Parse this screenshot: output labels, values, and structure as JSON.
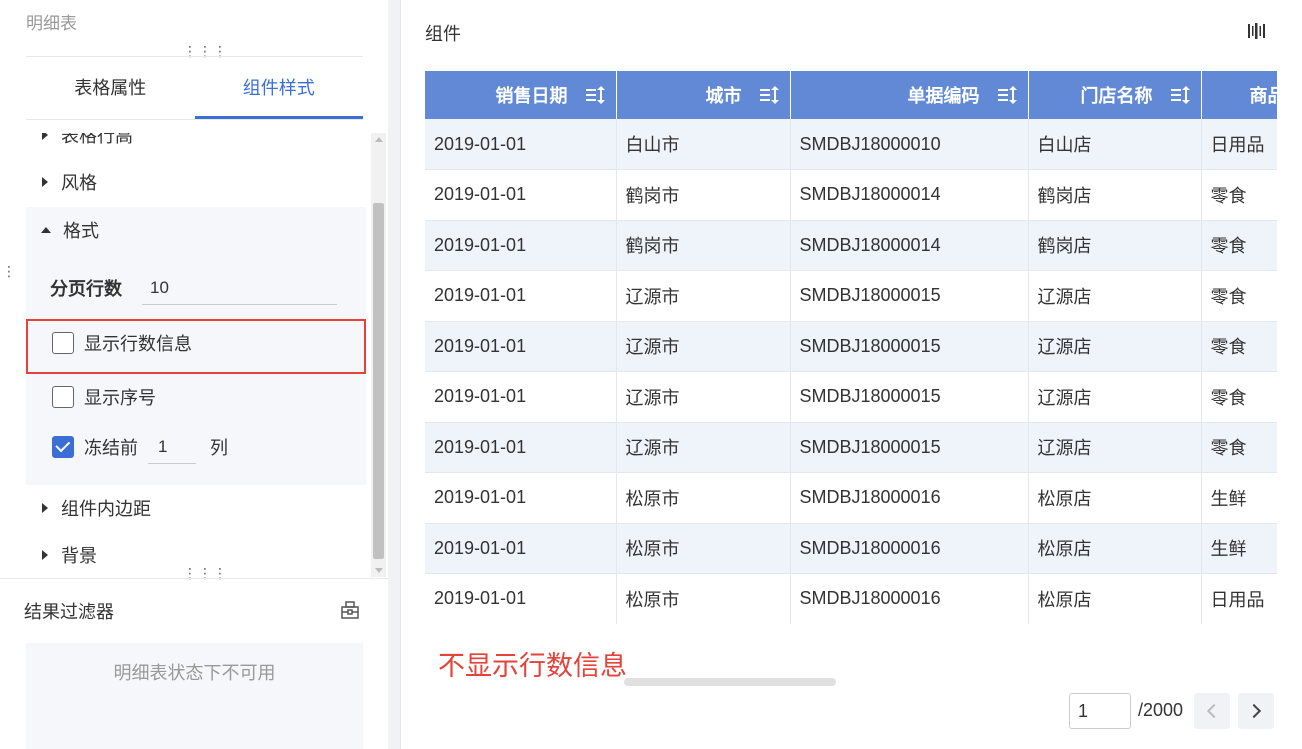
{
  "left": {
    "panel_title": "明细表",
    "tabs": [
      {
        "label": "表格属性",
        "active": false
      },
      {
        "label": "组件样式",
        "active": true
      }
    ],
    "sections": {
      "table_row_height": "表格行高",
      "style": "风格",
      "format": "格式",
      "padding": "组件内边距",
      "background": "背景"
    },
    "format": {
      "page_rows_label": "分页行数",
      "page_rows_value": "10",
      "show_row_count_label": "显示行数信息",
      "show_row_count_checked": false,
      "show_index_label": "显示序号",
      "show_index_checked": false,
      "freeze_prefix": "冻结前",
      "freeze_value": "1",
      "freeze_suffix": "列",
      "freeze_checked": true
    },
    "filter": {
      "title": "结果过滤器",
      "unavailable": "明细表状态下不可用"
    }
  },
  "right": {
    "title": "组件",
    "columns": [
      "销售日期",
      "城市",
      "单据编码",
      "门店名称",
      "商品"
    ],
    "rows": [
      [
        "2019-01-01",
        "白山市",
        "SMDBJ18000010",
        "白山店",
        "日用品"
      ],
      [
        "2019-01-01",
        "鹤岗市",
        "SMDBJ18000014",
        "鹤岗店",
        "零食"
      ],
      [
        "2019-01-01",
        "鹤岗市",
        "SMDBJ18000014",
        "鹤岗店",
        "零食"
      ],
      [
        "2019-01-01",
        "辽源市",
        "SMDBJ18000015",
        "辽源店",
        "零食"
      ],
      [
        "2019-01-01",
        "辽源市",
        "SMDBJ18000015",
        "辽源店",
        "零食"
      ],
      [
        "2019-01-01",
        "辽源市",
        "SMDBJ18000015",
        "辽源店",
        "零食"
      ],
      [
        "2019-01-01",
        "辽源市",
        "SMDBJ18000015",
        "辽源店",
        "零食"
      ],
      [
        "2019-01-01",
        "松原市",
        "SMDBJ18000016",
        "松原店",
        "生鲜"
      ],
      [
        "2019-01-01",
        "松原市",
        "SMDBJ18000016",
        "松原店",
        "生鲜"
      ],
      [
        "2019-01-01",
        "松原市",
        "SMDBJ18000016",
        "松原店",
        "日用品"
      ]
    ],
    "annotation": "不显示行数信息",
    "pager": {
      "current": "1",
      "total": "/2000"
    }
  },
  "colors": {
    "accent": "#3b6fd6",
    "header_bg": "#6289d5",
    "highlight": "#e4423a"
  }
}
